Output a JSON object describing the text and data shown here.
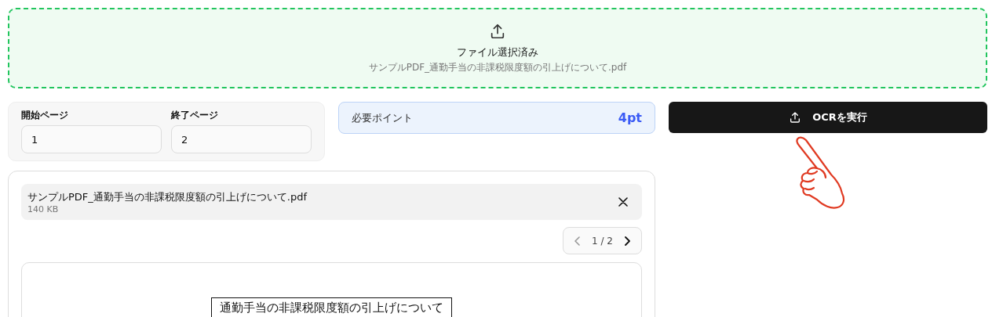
{
  "dropzone": {
    "title": "ファイル選択済み",
    "filename": "サンプルPDF_通勤手当の非課税限度額の引上げについて.pdf"
  },
  "page_range": {
    "fields": [
      {
        "label": "開始ページ",
        "value": "1"
      },
      {
        "label": "終了ページ",
        "value": "2"
      }
    ]
  },
  "points": {
    "label": "必要ポイント",
    "value": "4pt"
  },
  "run_button": {
    "label": "OCRを実行"
  },
  "preview": {
    "file": {
      "name": "サンプルPDF_通勤手当の非課税限度額の引上げについて.pdf",
      "size": "140 KB"
    },
    "pager": {
      "prev_disabled": true,
      "next_disabled": false,
      "text": "1 / 2"
    },
    "document_title": "通勤手当の非課税限度額の引上げについて"
  }
}
